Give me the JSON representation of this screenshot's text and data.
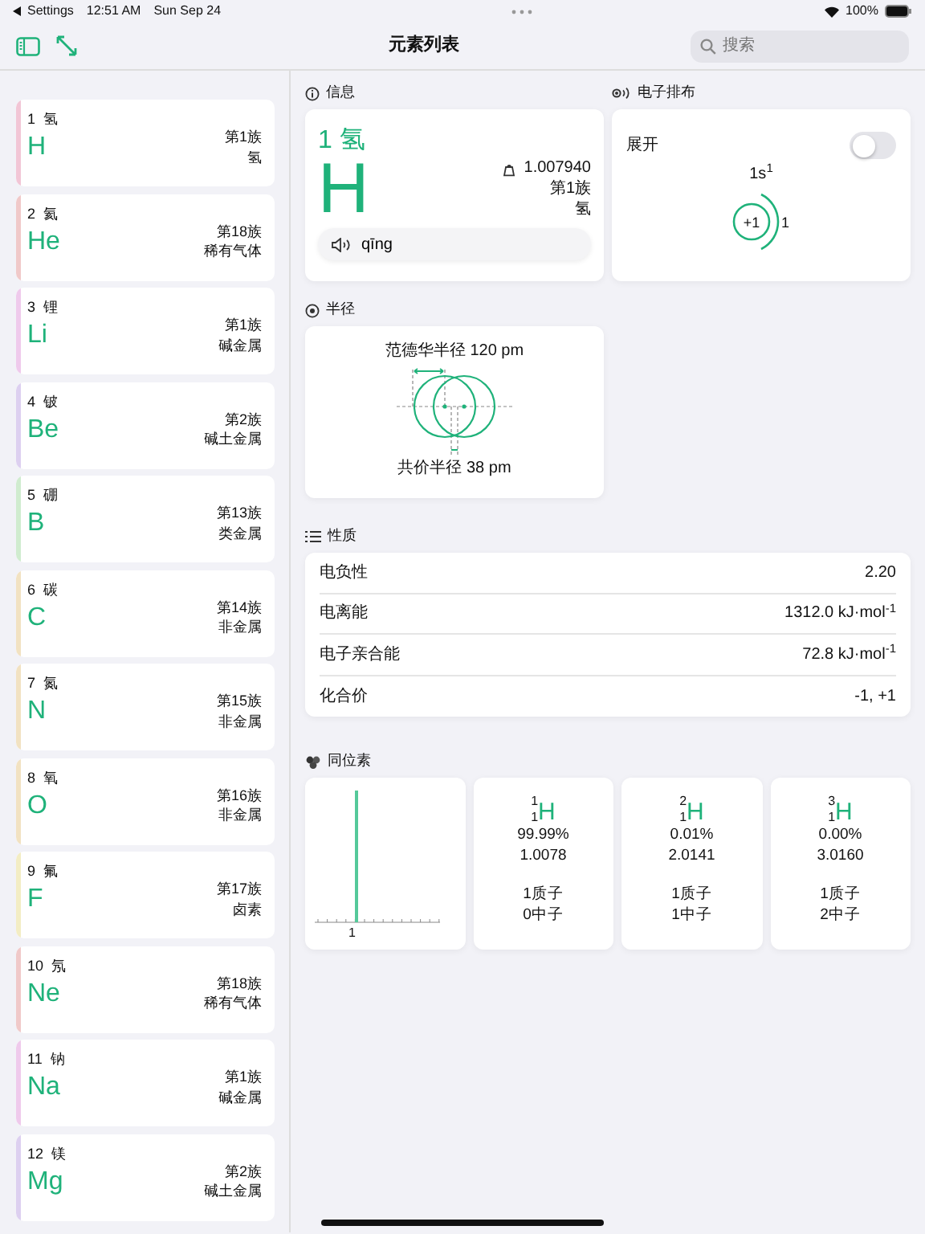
{
  "status_bar": {
    "back": "Settings",
    "time": "12:51 AM",
    "date": "Sun Sep 24",
    "battery": "100%"
  },
  "nav": {
    "title": "元素列表",
    "search": {
      "placeholder": "搜索"
    }
  },
  "sidebar": {
    "items": [
      {
        "number": "1",
        "name": "氢",
        "symbol": "H",
        "group": "第1族",
        "category": "氢",
        "color": "#f2c6d6"
      },
      {
        "number": "2",
        "name": "氦",
        "symbol": "He",
        "group": "第18族",
        "category": "稀有气体",
        "color": "#f0c9c9"
      },
      {
        "number": "3",
        "name": "锂",
        "symbol": "Li",
        "group": "第1族",
        "category": "碱金属",
        "color": "#efcaec"
      },
      {
        "number": "4",
        "name": "铍",
        "symbol": "Be",
        "group": "第2族",
        "category": "碱土金属",
        "color": "#ddd0f0"
      },
      {
        "number": "5",
        "name": "硼",
        "symbol": "B",
        "group": "第13族",
        "category": "类金属",
        "color": "#d0eccf"
      },
      {
        "number": "6",
        "name": "碳",
        "symbol": "C",
        "group": "第14族",
        "category": "非金属",
        "color": "#f2e2c2"
      },
      {
        "number": "7",
        "name": "氮",
        "symbol": "N",
        "group": "第15族",
        "category": "非金属",
        "color": "#f2e2c2"
      },
      {
        "number": "8",
        "name": "氧",
        "symbol": "O",
        "group": "第16族",
        "category": "非金属",
        "color": "#f2e2c2"
      },
      {
        "number": "9",
        "name": "氟",
        "symbol": "F",
        "group": "第17族",
        "category": "卤素",
        "color": "#f3edc4"
      },
      {
        "number": "10",
        "name": "氖",
        "symbol": "Ne",
        "group": "第18族",
        "category": "稀有气体",
        "color": "#f0c9c9"
      },
      {
        "number": "11",
        "name": "钠",
        "symbol": "Na",
        "group": "第1族",
        "category": "碱金属",
        "color": "#efcaec"
      },
      {
        "number": "12",
        "name": "镁",
        "symbol": "Mg",
        "group": "第2族",
        "category": "碱土金属",
        "color": "#ddd0f0"
      }
    ]
  },
  "info": {
    "heading": "信息",
    "title": "1 氢",
    "symbol": "H",
    "mass": "1.007940",
    "group": "第1族",
    "category": "氢",
    "pronunciation": "qīng"
  },
  "electrons": {
    "heading": "电子排布",
    "toggle_label": "展开",
    "on": false,
    "configuration": "1s$^{1}$",
    "nucleus": "+1",
    "shell_count": "1"
  },
  "radius": {
    "heading": "半径",
    "van_der_waals": "范德华半径 120 pm",
    "covalent": "共价半径 38 pm"
  },
  "properties": {
    "heading": "性质",
    "rows": [
      {
        "label": "电负性",
        "value": "2.20"
      },
      {
        "label": "电离能",
        "value": "1312.0 kJ·mol$^{-1}$"
      },
      {
        "label": "电子亲合能",
        "value": "72.8 kJ·mol$^{-1}$"
      },
      {
        "label": "化合价",
        "value": "-1, +1"
      }
    ]
  },
  "isotopes": {
    "heading": "同位素",
    "axis_label": "1",
    "items": [
      {
        "mass_number": "1",
        "atomic_number": "1",
        "symbol": "H",
        "abundance": "99.99%",
        "mass": "1.0078",
        "protons": "1质子",
        "neutrons": "0中子"
      },
      {
        "mass_number": "2",
        "atomic_number": "1",
        "symbol": "H",
        "abundance": "0.01%",
        "mass": "2.0141",
        "protons": "1质子",
        "neutrons": "1中子"
      },
      {
        "mass_number": "3",
        "atomic_number": "1",
        "symbol": "H",
        "abundance": "0.00%",
        "mass": "3.0160",
        "protons": "1质子",
        "neutrons": "2中子"
      }
    ]
  }
}
